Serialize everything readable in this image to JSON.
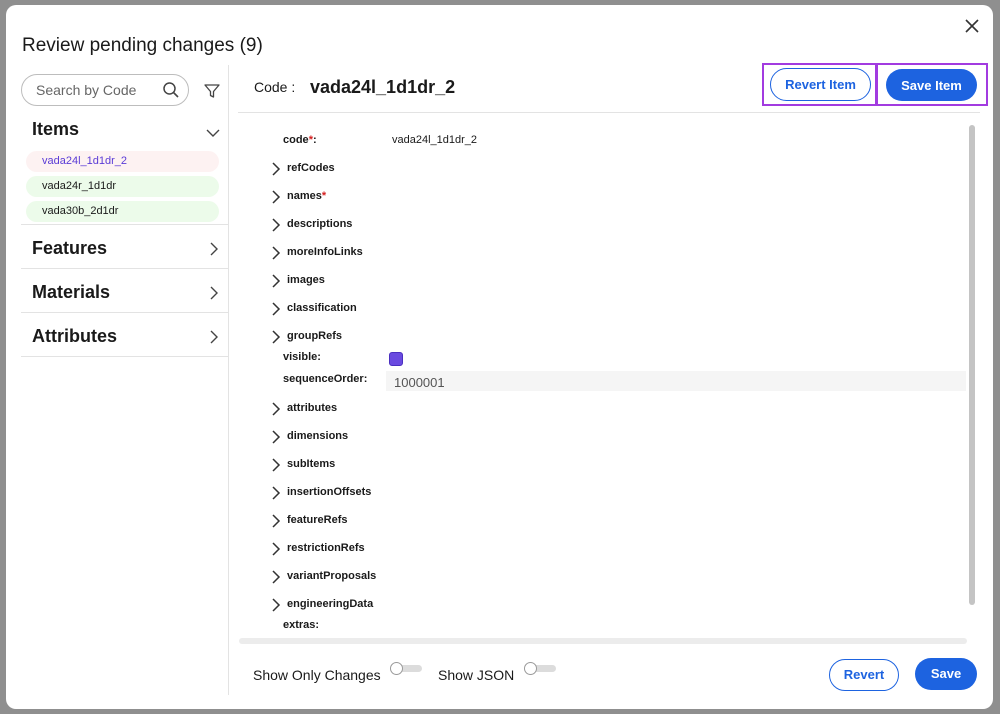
{
  "dialog": {
    "title": "Review pending changes (9)",
    "close_icon": "close-icon"
  },
  "sidebar": {
    "search_placeholder": "Search by Code",
    "search_icon": "search-icon",
    "filter_icon": "filter-icon",
    "sections": [
      {
        "label": "Items",
        "expanded": true
      },
      {
        "label": "Features",
        "expanded": false
      },
      {
        "label": "Materials",
        "expanded": false
      },
      {
        "label": "Attributes",
        "expanded": false
      }
    ],
    "items": [
      {
        "code": "vada24l_1d1dr_2",
        "selected": true
      },
      {
        "code": "vada24r_1d1dr",
        "selected": false
      },
      {
        "code": "vada30b_2d1dr",
        "selected": false
      }
    ]
  },
  "header": {
    "code_label": "Code :",
    "code_value": "vada24l_1d1dr_2",
    "revert_item_label": "Revert Item",
    "save_item_label": "Save Item"
  },
  "tree": {
    "code_label": "code",
    "code_req": "*",
    "code_colon": ":",
    "code_value": "vada24l_1d1dr_2",
    "refCodes": "refCodes",
    "names": "names",
    "names_req": "*",
    "descriptions": "descriptions",
    "moreInfoLinks": "moreInfoLinks",
    "images": "images",
    "classification": "classification",
    "groupRefs": "groupRefs",
    "visible_label": "visible:",
    "visible_checked": true,
    "sequenceOrder_label": "sequenceOrder:",
    "sequenceOrder_value": "1000001",
    "attributes": "attributes",
    "dimensions": "dimensions",
    "subItems": "subItems",
    "insertionOffsets": "insertionOffsets",
    "featureRefs": "featureRefs",
    "restrictionRefs": "restrictionRefs",
    "variantProposals": "variantProposals",
    "engineeringData": "engineeringData",
    "extras_label": "extras:"
  },
  "footer": {
    "show_only_changes_label": "Show Only Changes",
    "show_only_changes_on": false,
    "show_json_label": "Show JSON",
    "show_json_on": false,
    "revert_label": "Revert",
    "save_label": "Save"
  },
  "colors": {
    "accent": "#1d63e0",
    "highlight": "#a23be0",
    "selected_item_text": "#5a3bd6",
    "checkbox": "#6a4ae0",
    "item_bg": "#ecfbea"
  }
}
